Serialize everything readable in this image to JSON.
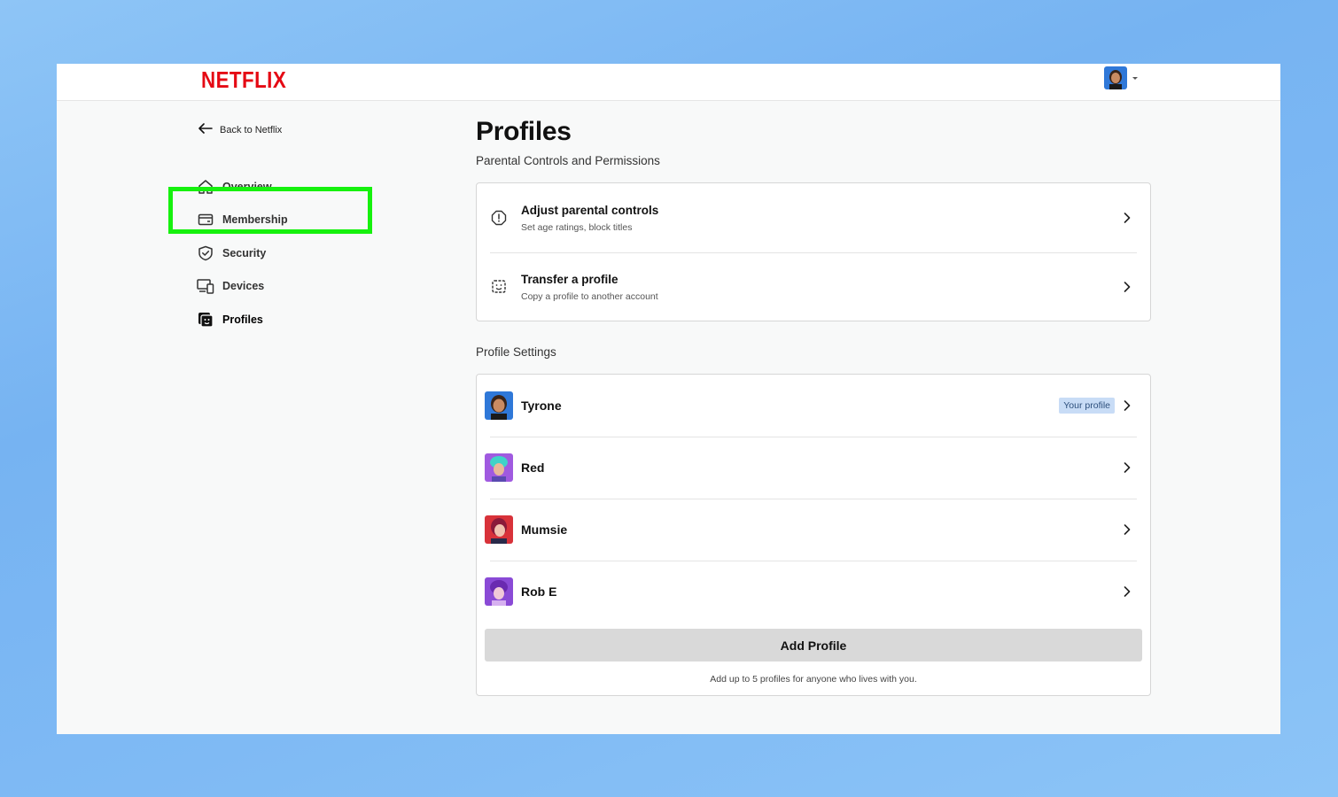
{
  "header": {
    "logo_text": "NETFLIX",
    "account_avatar": "tyrone-avatar"
  },
  "nav": {
    "back_label": "Back to Netflix",
    "items": [
      {
        "label": "Overview",
        "icon": "home-icon"
      },
      {
        "label": "Membership",
        "icon": "card-icon"
      },
      {
        "label": "Security",
        "icon": "shield-icon"
      },
      {
        "label": "Devices",
        "icon": "devices-icon"
      },
      {
        "label": "Profiles",
        "icon": "profiles-icon"
      }
    ],
    "active": "Profiles",
    "highlighted": "Membership",
    "highlight_color": "#16f10e"
  },
  "main": {
    "title": "Profiles",
    "subtitle": "Parental Controls and Permissions",
    "controls": [
      {
        "title": "Adjust parental controls",
        "desc": "Set age ratings, block titles",
        "icon": "alert-octagon-icon"
      },
      {
        "title": "Transfer a profile",
        "desc": "Copy a profile to another account",
        "icon": "profile-transfer-icon"
      }
    ],
    "profile_settings_label": "Profile Settings",
    "profiles": [
      {
        "name": "Tyrone",
        "badge": "Your profile",
        "avatar_color": "#2f78d8"
      },
      {
        "name": "Red",
        "badge": "",
        "avatar_color": "#a05ae0"
      },
      {
        "name": "Mumsie",
        "badge": "",
        "avatar_color": "#d8323a"
      },
      {
        "name": "Rob E",
        "badge": "",
        "avatar_color": "#8a4ad6"
      }
    ],
    "add_profile_label": "Add Profile",
    "add_profile_note": "Add up to 5 profiles for anyone who lives with you."
  },
  "colors": {
    "brand": "#e50914",
    "badge_bg": "#c8dcf6"
  }
}
